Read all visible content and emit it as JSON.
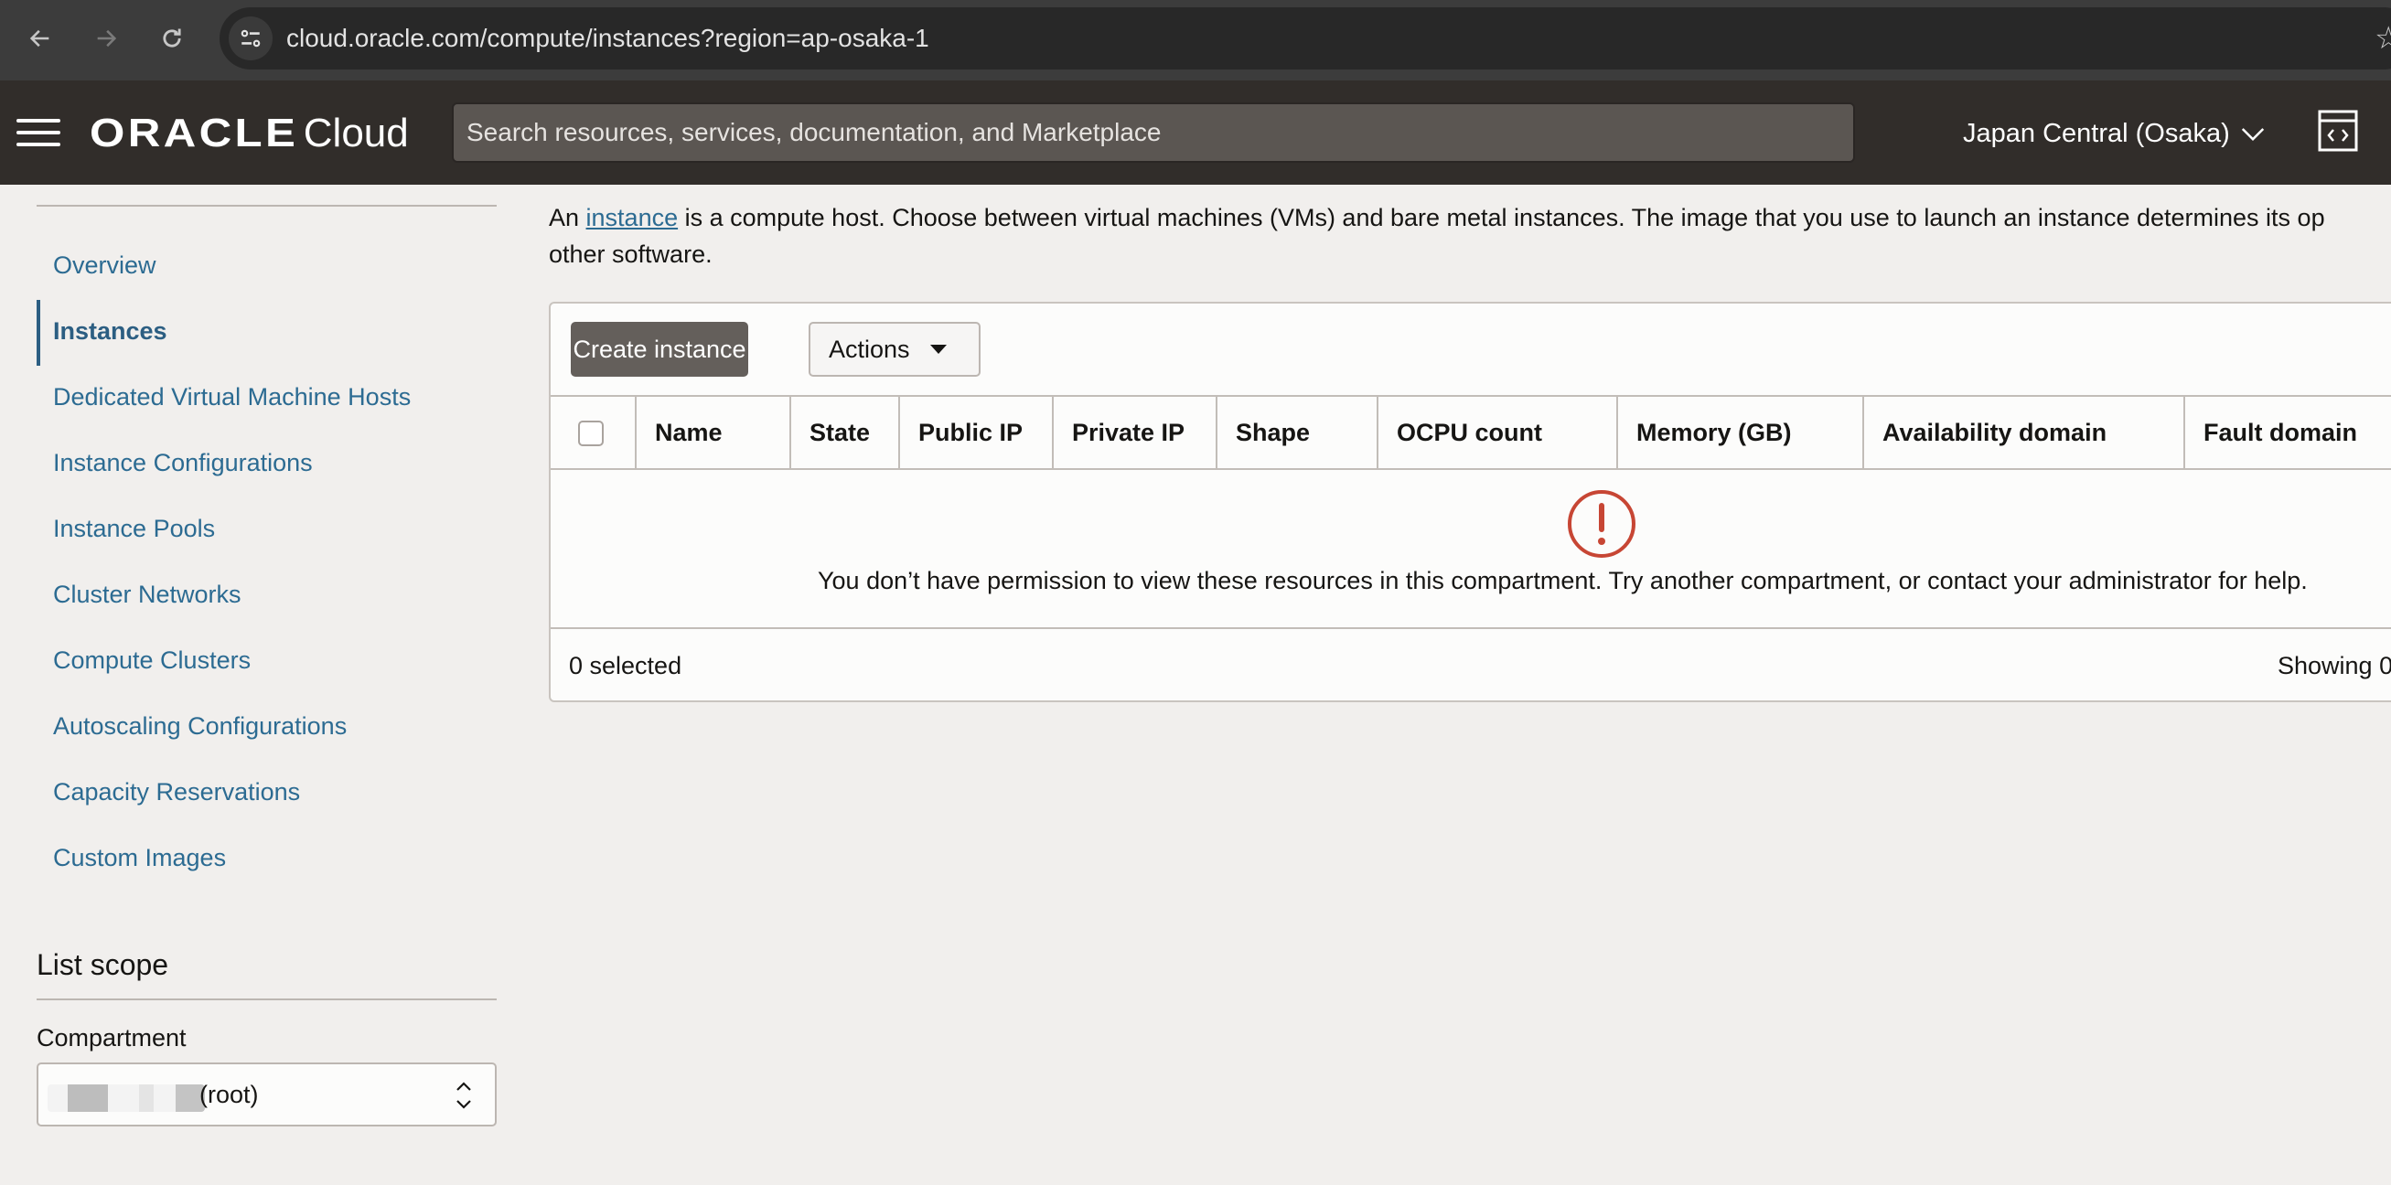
{
  "browser": {
    "url": "cloud.oracle.com/compute/instances?region=ap-osaka-1",
    "icons": {
      "back": "arrow-left-icon",
      "forward": "arrow-right-icon",
      "reload": "reload-icon",
      "site_info": "tune-icon",
      "bookmark": "star-icon"
    }
  },
  "header": {
    "logo_brand": "ORACLE",
    "logo_product": "Cloud",
    "search_placeholder": "Search resources, services, documentation, and Marketplace",
    "region": "Japan Central (Osaka)"
  },
  "sidebar": {
    "items": [
      {
        "label": "Overview",
        "active": false
      },
      {
        "label": "Instances",
        "active": true
      },
      {
        "label": "Dedicated Virtual Machine Hosts",
        "active": false
      },
      {
        "label": "Instance Configurations",
        "active": false
      },
      {
        "label": "Instance Pools",
        "active": false
      },
      {
        "label": "Cluster Networks",
        "active": false
      },
      {
        "label": "Compute Clusters",
        "active": false
      },
      {
        "label": "Autoscaling Configurations",
        "active": false
      },
      {
        "label": "Capacity Reservations",
        "active": false
      },
      {
        "label": "Custom Images",
        "active": false
      }
    ],
    "scope_title": "List scope",
    "compartment_label": "Compartment",
    "compartment_value": "(root)"
  },
  "main": {
    "description_pre": "An ",
    "description_link": "instance",
    "description_post": " is a compute host. Choose between virtual machines (VMs) and bare metal instances. The image that you use to launch an instance determines its op",
    "description_line2": "other software.",
    "toolbar": {
      "create_label": "Create instance",
      "actions_label": "Actions"
    },
    "table": {
      "columns": [
        "Name",
        "State",
        "Public IP",
        "Private IP",
        "Shape",
        "OCPU count",
        "Memory (GB)",
        "Availability domain",
        "Fault domain"
      ],
      "rows": [],
      "empty_message": "You don’t have permission to view these resources in this compartment. Try another compartment, or contact your administrator for help.",
      "selected_text": "0 selected",
      "showing_text": "Showing 0"
    }
  },
  "colors": {
    "link": "#2c6b92",
    "header_bg": "#312d2a",
    "primary_button": "#645f5b",
    "error": "#c74634"
  }
}
